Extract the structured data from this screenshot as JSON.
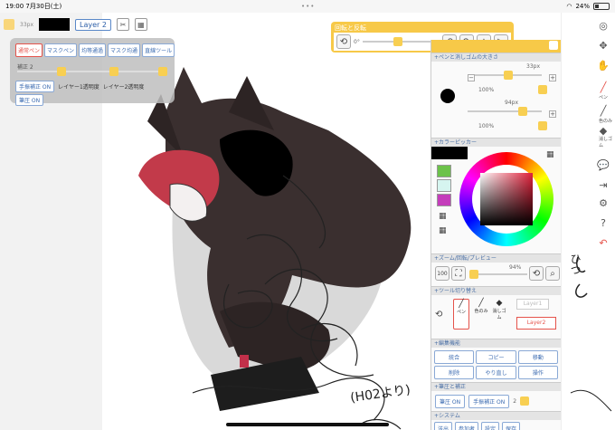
{
  "status": {
    "time": "19:00",
    "date": "7月30日(土)",
    "battery": "24%"
  },
  "toolbar": {
    "size_label": "33px",
    "layer_label": "Layer 2"
  },
  "brush_panel": {
    "tabs": [
      "通常ペン",
      "マスクペン",
      "均等通過",
      "マスク均通",
      "直線ツール"
    ],
    "correction_label": "補正 2",
    "layer1_label": "レイヤー1透明度",
    "layer2_label": "レイヤー2透明度",
    "hand_correction_btn": "手振補正 ON",
    "pressure_btn": "筆圧 ON"
  },
  "rotate_panel": {
    "title": "回転と反転",
    "angle": "0°"
  },
  "right_panel": {
    "pen_eraser_title": "+ペンと消しゴムの大きさ",
    "pen_size": "33px",
    "pen_opacity": "100%",
    "eraser_size": "94px",
    "eraser_opacity": "100%",
    "color_picker_title": "+カラーピッカー",
    "zoom_title": "+ズーム/回転/プレビュー",
    "zoom_value": "94%",
    "zoom_btn": "100",
    "tool_switch_title": "+ツール切り替え",
    "tools": [
      "ペン",
      "色のみ",
      "消しゴム"
    ],
    "layer1": "Layer1",
    "layer2": "Layer2",
    "edit_title": "+編集機能",
    "edit_buttons": [
      "統合",
      "コピー",
      "移動",
      "削除",
      "やり直し",
      "操作"
    ],
    "pressure_title": "+筆圧と補正",
    "pressure_btn": "筆圧 ON",
    "hand_btn": "手振補正 ON",
    "correction_value": "2",
    "system_title": "+システム",
    "system_buttons": [
      "送出",
      "参加者",
      "設定",
      "保存"
    ]
  },
  "canvas_text": {
    "handwriting": "(H02より)"
  },
  "right_strip": {
    "labels": [
      "ペン",
      "色のみ",
      "消しゴム"
    ],
    "vertical_text": "ひつ"
  }
}
